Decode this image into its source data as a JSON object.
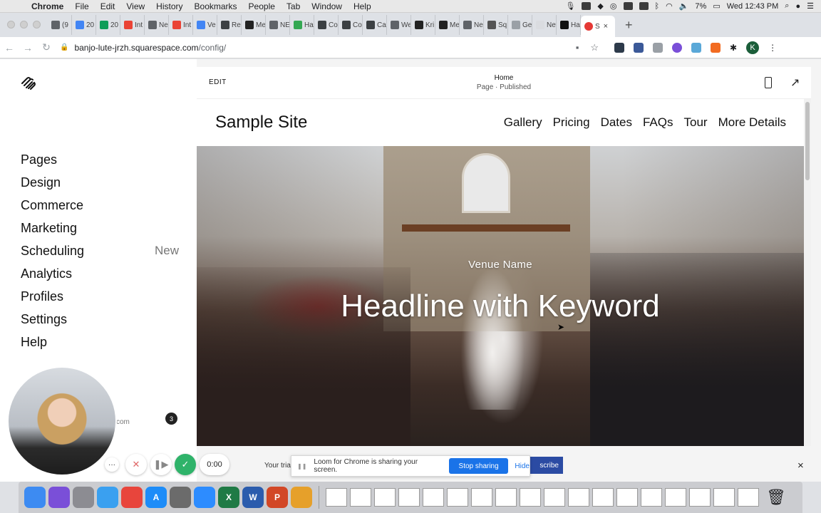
{
  "menubar": {
    "apple_glyph": "",
    "items": [
      "Chrome",
      "File",
      "Edit",
      "View",
      "History",
      "Bookmarks",
      "People",
      "Tab",
      "Window",
      "Help"
    ],
    "battery": "7%",
    "clock": "Wed 12:43 PM"
  },
  "tabs": [
    {
      "label": "(9",
      "color": "#5f6368"
    },
    {
      "label": "20",
      "color": "#4285f4"
    },
    {
      "label": "20",
      "color": "#0f9d58"
    },
    {
      "label": "Int",
      "color": "#ea4335"
    },
    {
      "label": "Ne",
      "color": "#5f6368"
    },
    {
      "label": "Int",
      "color": "#ea4335"
    },
    {
      "label": "Ve",
      "color": "#4285f4"
    },
    {
      "label": "Re",
      "color": "#3c4043"
    },
    {
      "label": "Me",
      "color": "#222"
    },
    {
      "label": "NE",
      "color": "#5f6368"
    },
    {
      "label": "Ha",
      "color": "#34a853"
    },
    {
      "label": "Co",
      "color": "#3c4043"
    },
    {
      "label": "Co",
      "color": "#3c4043"
    },
    {
      "label": "Ca",
      "color": "#3c4043"
    },
    {
      "label": "We",
      "color": "#5f6368"
    },
    {
      "label": "Kri",
      "color": "#222"
    },
    {
      "label": "Me",
      "color": "#222"
    },
    {
      "label": "Ne",
      "color": "#5f6368"
    },
    {
      "label": "Sq",
      "color": "#555"
    },
    {
      "label": "Ge",
      "color": "#9aa0a6"
    },
    {
      "label": "New Ta",
      "color": "#dadce0"
    },
    {
      "label": "Ha",
      "color": "#111"
    }
  ],
  "active_tab": {
    "label": "S",
    "close": "×"
  },
  "new_tab_glyph": "+",
  "address": {
    "domain": "banjo-lute-jrzh.squarespace.com",
    "path": "/config/"
  },
  "extensions": {
    "avatar_letter": "K"
  },
  "sidebar": {
    "nav": [
      {
        "label": "Pages",
        "badge": ""
      },
      {
        "label": "Design",
        "badge": ""
      },
      {
        "label": "Commerce",
        "badge": ""
      },
      {
        "label": "Marketing",
        "badge": ""
      },
      {
        "label": "Scheduling",
        "badge": "New"
      },
      {
        "label": "Analytics",
        "badge": ""
      },
      {
        "label": "Profiles",
        "badge": ""
      },
      {
        "label": "Settings",
        "badge": ""
      },
      {
        "label": "Help",
        "badge": ""
      }
    ],
    "notification_count": "3",
    "email_tail": "com"
  },
  "editor": {
    "edit_label": "EDIT",
    "page_title": "Home",
    "page_status": "Page · Published"
  },
  "site": {
    "title": "Sample Site",
    "nav": [
      "Gallery",
      "Pricing",
      "Dates",
      "FAQs",
      "Tour",
      "More Details"
    ],
    "hero_subtitle": "Venue Name",
    "hero_headline": "Headline with Keyword"
  },
  "trial": {
    "text": "Your tria",
    "subscribe": "scribe",
    "close": "×"
  },
  "loom": {
    "message": "Loom for Chrome is sharing your screen.",
    "stop": "Stop sharing",
    "hide": "Hide",
    "timer": "0:00",
    "more": "···",
    "cancel": "✕",
    "pause": "❚▶",
    "done": "✓"
  },
  "dock": {
    "apps": [
      {
        "name": "finder-icon",
        "color": "#3d8bf2",
        "glyph": ""
      },
      {
        "name": "siri-icon",
        "color": "#7a4fd8",
        "glyph": ""
      },
      {
        "name": "launchpad-icon",
        "color": "#8c8c92",
        "glyph": ""
      },
      {
        "name": "safari-icon",
        "color": "#3aa0f0",
        "glyph": ""
      },
      {
        "name": "chrome-icon",
        "color": "#e8453c",
        "glyph": ""
      },
      {
        "name": "app-store-icon",
        "color": "#1d8cf8",
        "glyph": "A"
      },
      {
        "name": "system-preferences-icon",
        "color": "#6b6b6b",
        "glyph": ""
      },
      {
        "name": "zoom-icon",
        "color": "#2d8cff",
        "glyph": ""
      },
      {
        "name": "excel-icon",
        "color": "#1f7a45",
        "glyph": "X"
      },
      {
        "name": "word-icon",
        "color": "#2b5cad",
        "glyph": "W"
      },
      {
        "name": "powerpoint-icon",
        "color": "#d24726",
        "glyph": "P"
      },
      {
        "name": "numbers-icon",
        "color": "#e6a02a",
        "glyph": ""
      }
    ]
  }
}
